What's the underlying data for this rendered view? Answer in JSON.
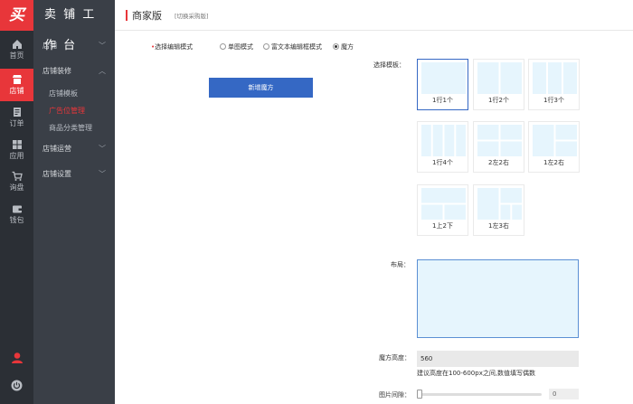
{
  "app": {
    "logo_text": "买",
    "workspace_title": "卖 铺 工 作 台"
  },
  "header": {
    "title": "商家版",
    "switch_link": "[切换采购版]"
  },
  "rail": [
    {
      "label": "首页",
      "icon": "home-icon"
    },
    {
      "label": "店铺",
      "icon": "store-icon",
      "active": true
    },
    {
      "label": "订单",
      "icon": "document-icon"
    },
    {
      "label": "应用",
      "icon": "grid-icon"
    },
    {
      "label": "询盘",
      "icon": "cart-icon"
    },
    {
      "label": "钱包",
      "icon": "wallet-icon"
    }
  ],
  "sidebar": {
    "groups": [
      {
        "label": "店铺",
        "chevron": "﹀"
      },
      {
        "label": "店铺装修",
        "chevron": "︿"
      },
      {
        "label": "店铺运营",
        "chevron": "﹀"
      },
      {
        "label": "店铺设置",
        "chevron": "﹀"
      }
    ],
    "sub_items": [
      {
        "label": "店铺模板"
      },
      {
        "label": "广告位管理",
        "active": true
      },
      {
        "label": "商品分类管理"
      }
    ]
  },
  "editor": {
    "mode_label": "选择编辑模式",
    "required_mark": "•",
    "modes": [
      {
        "label": "单图模式",
        "selected": false
      },
      {
        "label": "富文本编辑框模式",
        "selected": false
      },
      {
        "label": "魔方",
        "selected": true
      }
    ],
    "add_button": "新增魔方",
    "template_label": "选择模板：",
    "templates": [
      {
        "caption": "1行1个",
        "selected": true
      },
      {
        "caption": "1行2个"
      },
      {
        "caption": "1行3个"
      },
      {
        "caption": "1行4个"
      },
      {
        "caption": "2左2右"
      },
      {
        "caption": "1左2右"
      },
      {
        "caption": "1上2下"
      },
      {
        "caption": "1左3右"
      }
    ],
    "layout_label": "布局：",
    "height_label": "魔方高度：",
    "height_value": "560",
    "height_hint": "建议高度在100-600px之间,数值填写偶数",
    "gap_label": "图片间隙：",
    "gap_value": "0",
    "gap_level": 0
  },
  "colors": {
    "accent": "#e8363a",
    "primary": "#3568c4",
    "cell": "#e6f5fd"
  }
}
